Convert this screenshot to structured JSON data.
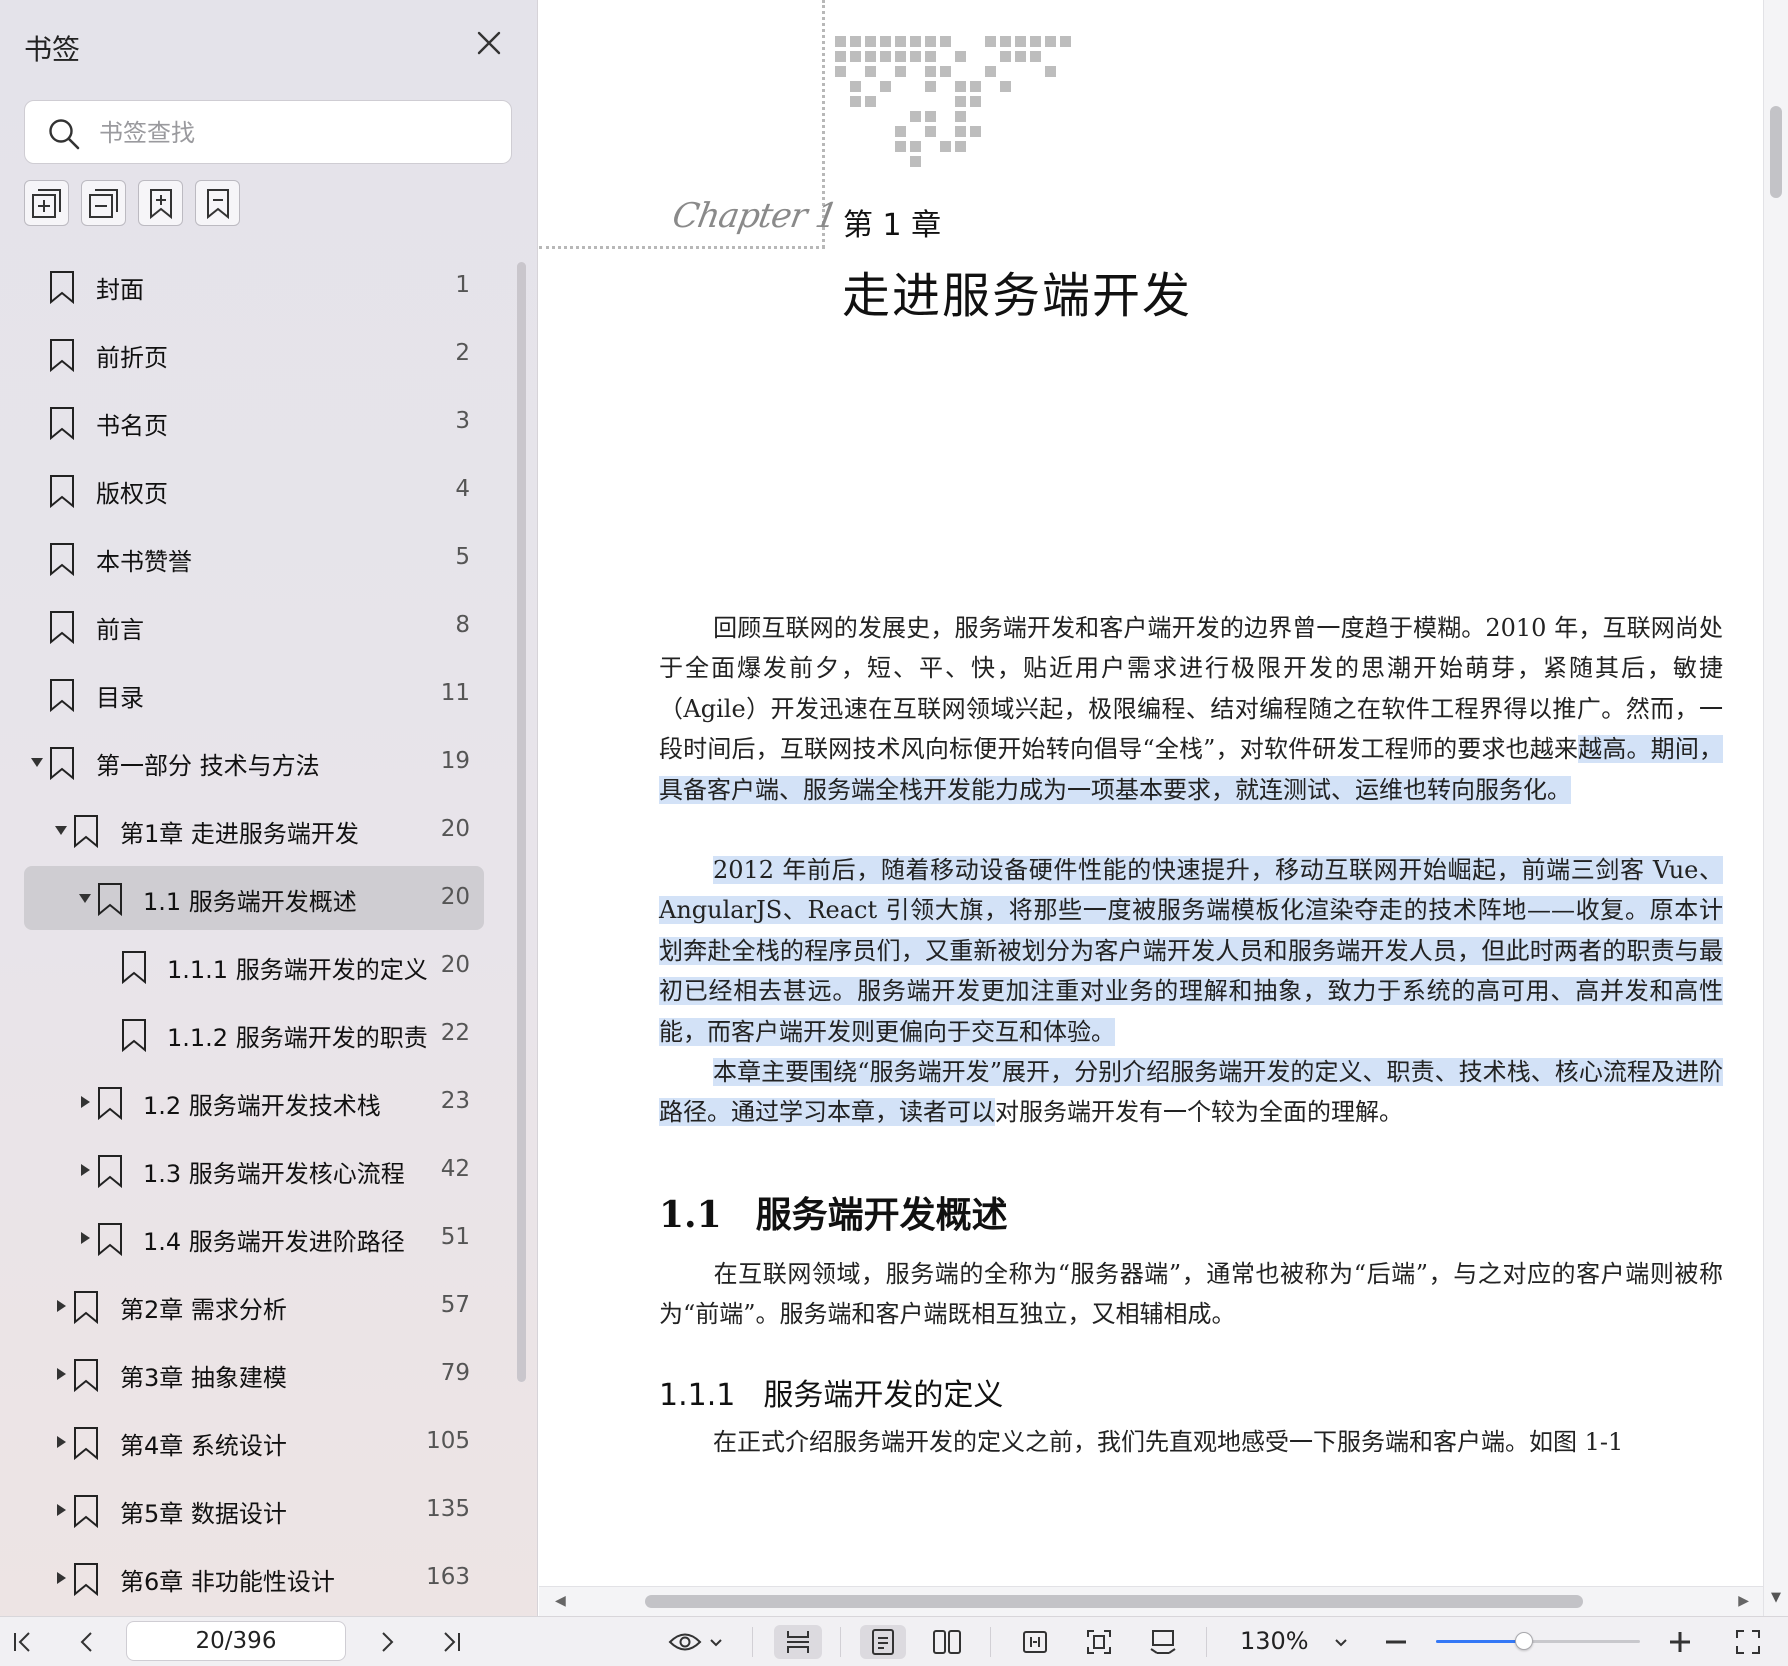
{
  "sidebar": {
    "title": "书签",
    "search_placeholder": "书签查找",
    "tools": [
      "expand-all-icon",
      "collapse-all-icon",
      "add-bookmark-icon",
      "remove-bookmark-icon"
    ],
    "items": [
      {
        "label": "封面",
        "page": "1",
        "level": 0,
        "expander": "none"
      },
      {
        "label": "前折页",
        "page": "2",
        "level": 0,
        "expander": "none"
      },
      {
        "label": "书名页",
        "page": "3",
        "level": 0,
        "expander": "none"
      },
      {
        "label": "版权页",
        "page": "4",
        "level": 0,
        "expander": "none"
      },
      {
        "label": "本书赞誉",
        "page": "5",
        "level": 0,
        "expander": "none"
      },
      {
        "label": "前言",
        "page": "8",
        "level": 0,
        "expander": "none"
      },
      {
        "label": "目录",
        "page": "11",
        "level": 0,
        "expander": "none"
      },
      {
        "label": "第一部分 技术与方法",
        "page": "19",
        "level": 0,
        "expander": "expanded"
      },
      {
        "label": "第1章 走进服务端开发",
        "page": "20",
        "level": 1,
        "expander": "expanded"
      },
      {
        "label": "1.1 服务端开发概述",
        "page": "20",
        "level": 2,
        "expander": "expanded",
        "selected": true
      },
      {
        "label": "1.1.1 服务端开发的定义",
        "page": "20",
        "level": 3,
        "expander": "none"
      },
      {
        "label": "1.1.2 服务端开发的职责",
        "page": "22",
        "level": 3,
        "expander": "none"
      },
      {
        "label": "1.2 服务端开发技术栈",
        "page": "23",
        "level": 2,
        "expander": "collapsed"
      },
      {
        "label": "1.3 服务端开发核心流程",
        "page": "42",
        "level": 2,
        "expander": "collapsed"
      },
      {
        "label": "1.4 服务端开发进阶路径",
        "page": "51",
        "level": 2,
        "expander": "collapsed"
      },
      {
        "label": "第2章 需求分析",
        "page": "57",
        "level": 1,
        "expander": "collapsed"
      },
      {
        "label": "第3章 抽象建模",
        "page": "79",
        "level": 1,
        "expander": "collapsed"
      },
      {
        "label": "第4章 系统设计",
        "page": "105",
        "level": 1,
        "expander": "collapsed"
      },
      {
        "label": "第5章 数据设计",
        "page": "135",
        "level": 1,
        "expander": "collapsed"
      },
      {
        "label": "第6章 非功能性设计",
        "page": "163",
        "level": 1,
        "expander": "collapsed"
      }
    ]
  },
  "document": {
    "chapter_script": "Chapter 1",
    "chapter_number": "第 1 章",
    "chapter_title": "走进服务端开发",
    "p1": [
      {
        "t": "回顾互联网的发展史，服务端开发和客户端开发的边界曾一度趋于模糊。2010 年，互联网尚处于全面爆发前夕，短、平、快，贴近用户需求进行极限开发的思潮开始萌芽，紧随其后，敏捷（Agile）开发迅速在互联网领域兴起，极限编程、结对编程随之在软件工程界得以推广。然而，一段时间后，互联网技术风向标便开始转向倡导“全栈”，对软件研发工程师的要求也越来",
        "hl": false
      },
      {
        "t": "越高。期间，具备客户端、服务端全栈开发能力成为一项基本要求，就连测试、运维也转向服务化。",
        "hl": true
      }
    ],
    "p2": "2012 年前后，随着移动设备硬件性能的快速提升，移动互联网开始崛起，前端三剑客 Vue、AngularJS、React 引领大旗，将那些一度被服务端模板化渲染夺走的技术阵地——收复。原本计划奔赴全栈的程序员们，又重新被划分为客户端开发人员和服务端开发人员，但此时两者的职责与最初已经相去甚远。服务端开发更加注重对业务的理解和抽象，致力于系统的高可用、高并发和高性能，而客户端开发则更偏向于交互和体验。",
    "p3": [
      {
        "t": "本章主要围绕“服务端开发”展开，分别介绍服务端开发的定义、职责、技术栈、核心流程及进阶路径。通过学习本章，读者可以",
        "hl": true
      },
      {
        "t": "对服务端开发有一个较为全面的理解。",
        "hl": false
      }
    ],
    "section_num": "1.1",
    "section_title": "服务端开发概述",
    "p4": "在互联网领域，服务端的全称为“服务器端”，通常也被称为“后端”，与之对应的客户端则被称为“前端”。服务端和客户端既相互独立，又相辅相成。",
    "subsection_num": "1.1.1",
    "subsection_title": "服务端开发的定义",
    "p5": "在正式介绍服务端开发的定义之前，我们先直观地感受一下服务端和客户端。如图 1-1"
  },
  "toolbar": {
    "page_value": "20/396",
    "zoom": "130%",
    "zoom_level_fraction": 0.43,
    "accent": "#3478f6"
  }
}
